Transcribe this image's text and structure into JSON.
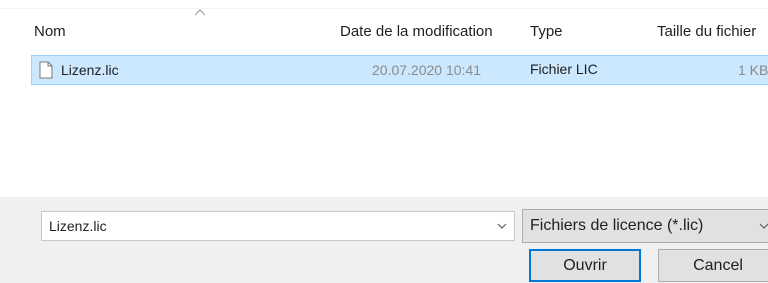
{
  "columns": {
    "name": "Nom",
    "date": "Date de la modification",
    "type": "Type",
    "size": "Taille du fichier"
  },
  "files": [
    {
      "name": "Lizenz.lic",
      "date": "20.07.2020 10:41",
      "type": "Fichier LIC",
      "size": "1 KB"
    }
  ],
  "filename_field": {
    "value": "Lizenz.lic"
  },
  "filter": {
    "selected": "Fichiers de licence (*.lic)"
  },
  "buttons": {
    "open_label": "Ouvrir",
    "cancel_label": "Cancel"
  },
  "colors": {
    "selection_bg": "#cce8ff",
    "selection_border": "#99d1ff",
    "focus_border": "#0078d7",
    "button_bg": "#e1e1e1",
    "dialog_bg": "#f0f0f0"
  },
  "icons": {
    "sort": "sort-ascending-icon",
    "file": "file-icon",
    "dropdown": "chevron-down-icon"
  }
}
